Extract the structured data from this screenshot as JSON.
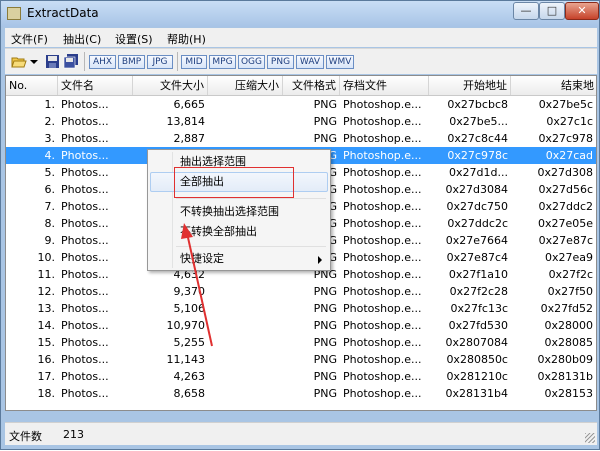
{
  "window": {
    "title": "ExtractData",
    "min_glyph": "—",
    "max_glyph": "□",
    "close_glyph": "✕"
  },
  "menu": [
    "文件(F)",
    "抽出(C)",
    "设置(S)",
    "帮助(H)"
  ],
  "toolbar": {
    "formats": [
      "AHX",
      "BMP",
      "JPG",
      "MID",
      "MPG",
      "OGG",
      "PNG",
      "WAV",
      "WMV"
    ],
    "icons": [
      "open-folder-icon",
      "dropdown-arrow-icon",
      "save-icon",
      "save-all-icon"
    ]
  },
  "list": {
    "headers": [
      "No.",
      "文件名",
      "文件大小",
      "压缩大小",
      "文件格式",
      "存档文件",
      "开始地址",
      "结束地"
    ],
    "rows": [
      {
        "no": "1.",
        "name": "Photos...",
        "size": "6,665",
        "comp": "",
        "fmt": "PNG",
        "archive": "Photoshop.e...",
        "start": "0x27bcbc8",
        "end": "0x27be5c"
      },
      {
        "no": "2.",
        "name": "Photos...",
        "size": "13,814",
        "comp": "",
        "fmt": "PNG",
        "archive": "Photoshop.e...",
        "start": "0x27be5...",
        "end": "0x27c1c"
      },
      {
        "no": "3.",
        "name": "Photos...",
        "size": "2,887",
        "comp": "",
        "fmt": "PNG",
        "archive": "Photoshop.e...",
        "start": "0x27c8c44",
        "end": "0x27c978"
      },
      {
        "no": "4.",
        "name": "Photos...",
        "size": "",
        "comp": "",
        "fmt": "PNG",
        "archive": "Photoshop.e...",
        "start": "0x27c978c",
        "end": "0x27cad"
      },
      {
        "no": "5.",
        "name": "Photos...",
        "size": "",
        "comp": "",
        "fmt": "PNG",
        "archive": "Photoshop.e...",
        "start": "0x27d1d...",
        "end": "0x27d308"
      },
      {
        "no": "6.",
        "name": "Photos...",
        "size": "",
        "comp": "",
        "fmt": "PNG",
        "archive": "Photoshop.e...",
        "start": "0x27d3084",
        "end": "0x27d56c"
      },
      {
        "no": "7.",
        "name": "Photos...",
        "size": "",
        "comp": "",
        "fmt": "PNG",
        "archive": "Photoshop.e...",
        "start": "0x27dc750",
        "end": "0x27ddc2"
      },
      {
        "no": "8.",
        "name": "Photos...",
        "size": "",
        "comp": "",
        "fmt": "PNG",
        "archive": "Photoshop.e...",
        "start": "0x27ddc2c",
        "end": "0x27e05e"
      },
      {
        "no": "9.",
        "name": "Photos...",
        "size": "",
        "comp": "",
        "fmt": "PNG",
        "archive": "Photoshop.e...",
        "start": "0x27e7664",
        "end": "0x27e87c"
      },
      {
        "no": "10.",
        "name": "Photos...",
        "size": "",
        "comp": "",
        "fmt": "PNG",
        "archive": "Photoshop.e...",
        "start": "0x27e87c4",
        "end": "0x27ea9"
      },
      {
        "no": "11.",
        "name": "Photos...",
        "size": "4,632",
        "comp": "",
        "fmt": "PNG",
        "archive": "Photoshop.e...",
        "start": "0x27f1a10",
        "end": "0x27f2c"
      },
      {
        "no": "12.",
        "name": "Photos...",
        "size": "9,370",
        "comp": "",
        "fmt": "PNG",
        "archive": "Photoshop.e...",
        "start": "0x27f2c28",
        "end": "0x27f50"
      },
      {
        "no": "13.",
        "name": "Photos...",
        "size": "5,106",
        "comp": "",
        "fmt": "PNG",
        "archive": "Photoshop.e...",
        "start": "0x27fc13c",
        "end": "0x27fd52"
      },
      {
        "no": "14.",
        "name": "Photos...",
        "size": "10,970",
        "comp": "",
        "fmt": "PNG",
        "archive": "Photoshop.e...",
        "start": "0x27fd530",
        "end": "0x28000"
      },
      {
        "no": "15.",
        "name": "Photos...",
        "size": "5,255",
        "comp": "",
        "fmt": "PNG",
        "archive": "Photoshop.e...",
        "start": "0x2807084",
        "end": "0x28085"
      },
      {
        "no": "16.",
        "name": "Photos...",
        "size": "11,143",
        "comp": "",
        "fmt": "PNG",
        "archive": "Photoshop.e...",
        "start": "0x280850c",
        "end": "0x280b09"
      },
      {
        "no": "17.",
        "name": "Photos...",
        "size": "4,263",
        "comp": "",
        "fmt": "PNG",
        "archive": "Photoshop.e...",
        "start": "0x281210c",
        "end": "0x28131b"
      },
      {
        "no": "18.",
        "name": "Photos...",
        "size": "8,658",
        "comp": "",
        "fmt": "PNG",
        "archive": "Photoshop.e...",
        "start": "0x28131b4",
        "end": "0x28153"
      }
    ]
  },
  "context_menu": {
    "items": [
      "抽出选择范围",
      "全部抽出",
      "不转换抽出选择范围",
      "不转换全部抽出",
      "快捷设定"
    ]
  },
  "status": {
    "label": "文件数",
    "value": "213"
  },
  "colors": {
    "selection": "#3399ff",
    "highlight_box": "#e03030",
    "arrow": "#e03030",
    "titlebar": "#a7c4e6"
  }
}
